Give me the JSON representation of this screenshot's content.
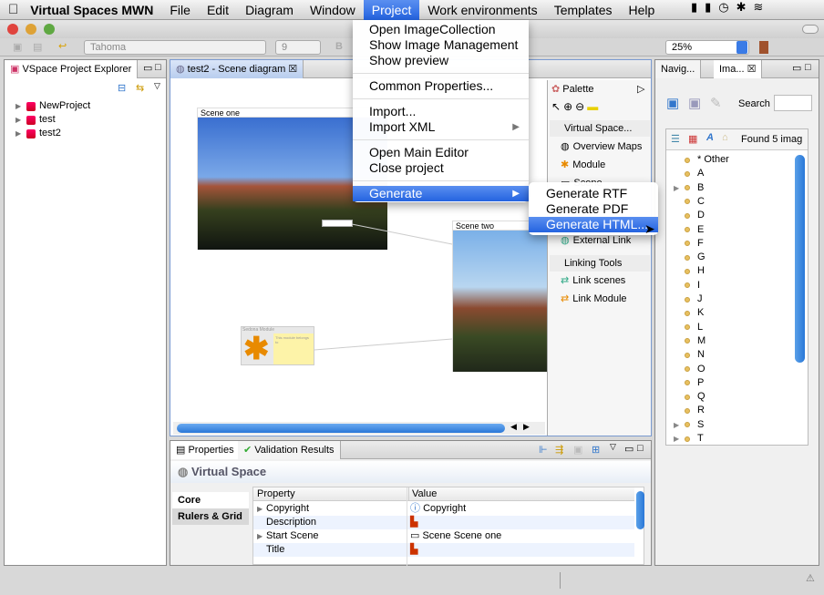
{
  "menubar": {
    "app_name": "Virtual Spaces MWN",
    "items": [
      "File",
      "Edit",
      "Diagram",
      "Window",
      "Project",
      "Work environments",
      "Templates",
      "Help"
    ],
    "active": "Project"
  },
  "toolbar": {
    "font": "Tahoma",
    "size": "9",
    "zoom": "25%"
  },
  "explorer": {
    "tab": "VSpace Project Explorer",
    "items": [
      "NewProject",
      "test",
      "test2"
    ]
  },
  "editor": {
    "tab": "test2 - Scene diagram",
    "scene_one": "Scene one",
    "scene_two": "Scene two",
    "module_title": "Sedona Module",
    "module_note": "This module belongs to"
  },
  "palette": {
    "title": "Palette",
    "groups": [
      {
        "label": "Virtual Space...",
        "items": [
          "Overview Maps",
          "Module",
          "Scene",
          "External Link"
        ]
      },
      {
        "label": "Linking Tools",
        "items": [
          "Link scenes",
          "Link Module"
        ]
      }
    ]
  },
  "project_menu": {
    "items": [
      "Open ImageCollection",
      "Show Image Management",
      "Show preview",
      "Common Properties...",
      "Import...",
      "Import XML",
      "Open Main Editor",
      "Close project",
      "Generate"
    ]
  },
  "generate_submenu": {
    "items": [
      "Generate RTF",
      "Generate PDF",
      "Generate HTML..."
    ],
    "highlighted": "Generate HTML..."
  },
  "right_panel": {
    "tabs": [
      "Navig...",
      "Ima..."
    ],
    "search_label": "Search",
    "search_value": "",
    "found": "Found 5 imag",
    "items": [
      "* Other",
      "A",
      "B",
      "C",
      "D",
      "E",
      "F",
      "G",
      "H",
      "I",
      "J",
      "K",
      "L",
      "M",
      "N",
      "O",
      "P",
      "Q",
      "R",
      "S",
      "T"
    ],
    "expandable": [
      "B",
      "S",
      "T"
    ]
  },
  "properties": {
    "tabs": [
      "Properties",
      "Validation Results"
    ],
    "title": "Virtual Space",
    "sections": [
      "Core",
      "Rulers & Grid"
    ],
    "columns": [
      "Property",
      "Value"
    ],
    "rows": [
      {
        "property": "Copyright",
        "value": "Copyright",
        "expandable": true
      },
      {
        "property": "Description",
        "value": "",
        "expandable": false
      },
      {
        "property": "Start Scene",
        "value": "Scene Scene one",
        "expandable": true
      },
      {
        "property": "Title",
        "value": "",
        "expandable": false
      }
    ]
  },
  "colors": {
    "accent": "#2463e0",
    "selection": "#3a75e6"
  }
}
